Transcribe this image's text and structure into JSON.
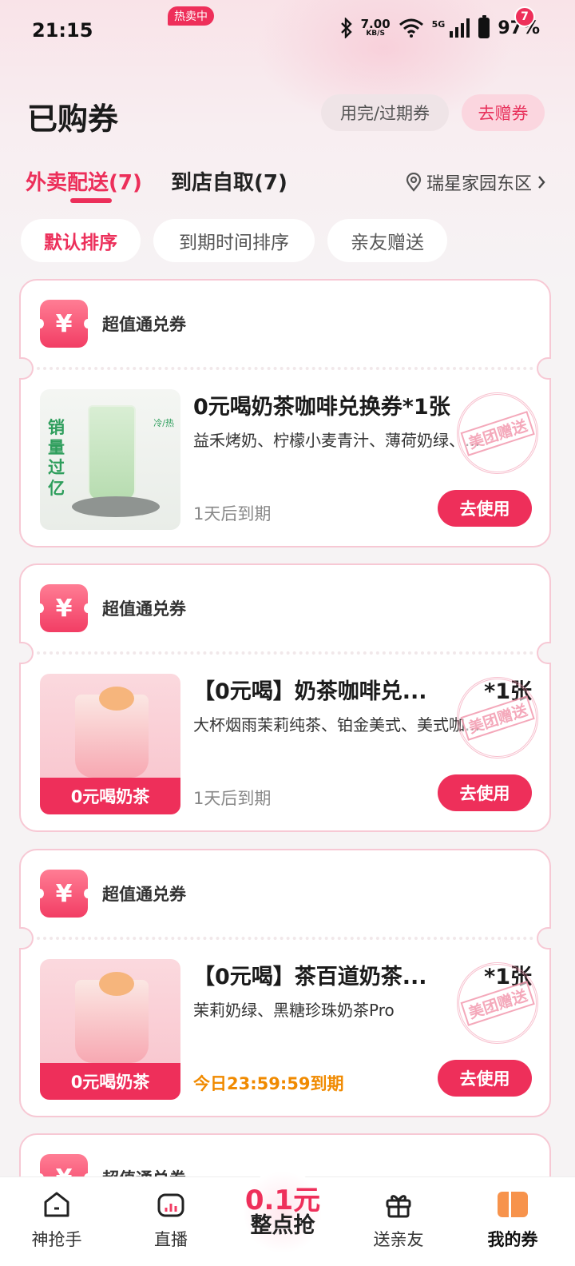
{
  "status_bar": {
    "time": "21:15",
    "speed_value": "7.00",
    "speed_unit": "KB/S",
    "network": "5G",
    "battery": "97%"
  },
  "header": {
    "title": "已购券",
    "expired_button": "用完/过期券",
    "gift_button": "去赠券"
  },
  "tabs": [
    {
      "label": "外卖配送(7)",
      "active": true
    },
    {
      "label": "到店自取(7)",
      "active": false
    }
  ],
  "location": "瑞星家园东区",
  "filters": [
    {
      "label": "默认排序",
      "active": true
    },
    {
      "label": "到期时间排序",
      "active": false
    },
    {
      "label": "亲友赠送",
      "active": false
    }
  ],
  "coupons": [
    {
      "type": "超值通兑券",
      "title": "0元喝奶茶咖啡兑换券*1张",
      "quantity": "",
      "description": "益禾烤奶、柠檬小麦青汁、薄荷奶绿、...",
      "expiry": "1天后到期",
      "image_text": "销量过亿",
      "image_tag": "冷/热",
      "stamp": "美团赠送",
      "button": "去使用"
    },
    {
      "type": "超值通兑券",
      "title": "【0元喝】奶茶咖啡兑...",
      "quantity": "*1张",
      "description": "大杯烟雨茉莉纯茶、铂金美式、美式咖...",
      "expiry": "1天后到期",
      "image_banner": "0元喝奶茶",
      "stamp": "美团赠送",
      "button": "去使用"
    },
    {
      "type": "超值通兑券",
      "title": "【0元喝】茶百道奶茶...",
      "quantity": "*1张",
      "description": "茉莉奶绿、黑糖珍珠奶茶Pro",
      "expiry": "今日23:59:59到期",
      "image_banner": "0元喝奶茶",
      "stamp": "美团赠送",
      "button": "去使用"
    },
    {
      "type": "超值通兑券"
    }
  ],
  "bottom_nav": {
    "items": [
      {
        "label": "神抢手",
        "icon": "home-icon"
      },
      {
        "label": "直播",
        "icon": "live-icon",
        "badge": "热卖中"
      },
      {
        "label": "送亲友",
        "icon": "gift-icon"
      },
      {
        "label": "我的券",
        "icon": "ticket-icon",
        "badge": "7",
        "active": true
      }
    ],
    "promo_price": "0.1元",
    "promo_text": "整点抢"
  },
  "colors": {
    "accent": "#ee2f5a",
    "card_border": "#f7c8d4",
    "expiry_today": "#f08a00"
  }
}
